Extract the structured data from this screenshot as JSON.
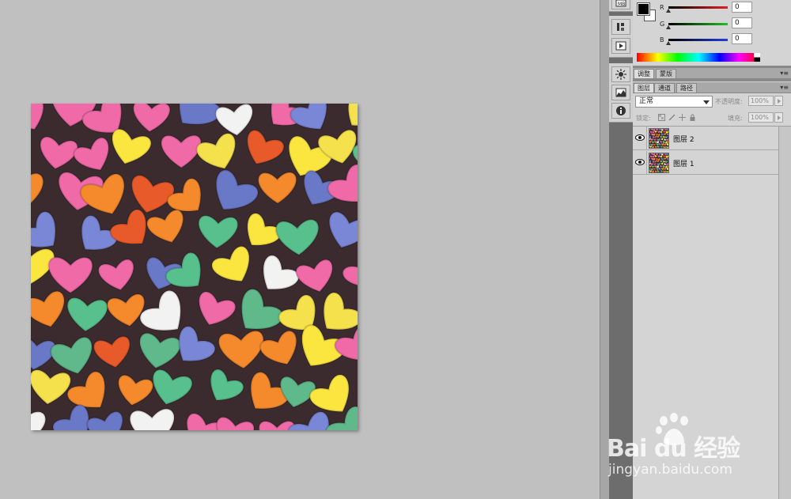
{
  "color_panel": {
    "channels": [
      {
        "label": "R",
        "value": "0",
        "color": "#e02020"
      },
      {
        "label": "G",
        "value": "0",
        "color": "#20c020"
      },
      {
        "label": "B",
        "value": "0",
        "color": "#2040e0"
      }
    ],
    "foreground": "#000000",
    "background": "#ffffff"
  },
  "adjust_tabs": [
    {
      "label": "调整",
      "active": true
    },
    {
      "label": "蒙版",
      "active": false
    }
  ],
  "layer_tabs": [
    {
      "label": "图层",
      "active": true
    },
    {
      "label": "通道",
      "active": false
    },
    {
      "label": "路径",
      "active": false
    }
  ],
  "layers_panel": {
    "blend_mode": "正常",
    "opacity_label": "不透明度:",
    "opacity_value": "100%",
    "lock_label": "锁定:",
    "fill_label": "填充:",
    "fill_value": "100%",
    "layers": [
      {
        "name": "图层 2",
        "visible": true
      },
      {
        "name": "图层 1",
        "visible": true
      }
    ]
  },
  "icons": {
    "panel_icons": [
      "mb-icon",
      "brush-presets-icon",
      "play-icon",
      "adjustments-icon",
      "histogram-icon",
      "info-icon"
    ]
  },
  "watermark": {
    "logo": "Bai du 经验",
    "url": "jingyan.baidu.com"
  }
}
